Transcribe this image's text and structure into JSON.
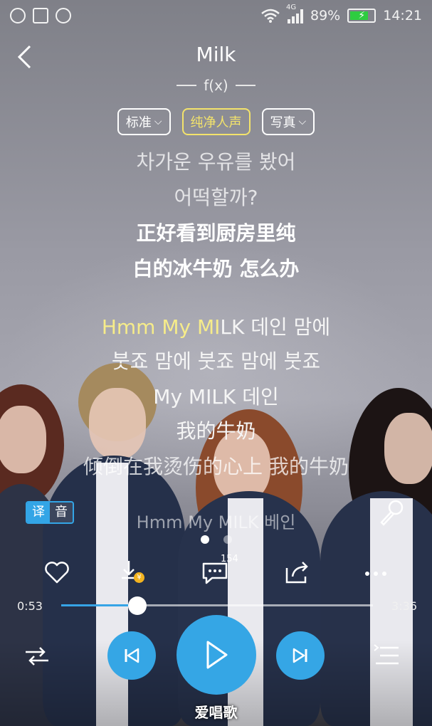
{
  "status": {
    "network": "4G",
    "battery": "89%",
    "time": "14:21"
  },
  "song": {
    "title": "Milk",
    "artist": "f(x)"
  },
  "chips": [
    {
      "label": "标准",
      "icon": "chevron-down-icon"
    },
    {
      "label": "纯净人声",
      "active": true
    },
    {
      "label": "写真",
      "icon": "chevron-down-icon"
    }
  ],
  "lyrics": {
    "l1": "차가운 우유를 봤어",
    "l2": "어떡할까?",
    "l3": "正好看到厨房里纯",
    "l4": "白的冰牛奶 怎么办",
    "l5_hl": "Hmm My MI",
    "l5_rest": "LK 데인 맘에",
    "l6": "붓죠 맘에 붓죠 맘에 붓죠",
    "l7": "My MILK 데인",
    "l8": "我的牛奶",
    "l9": "倾倒在我烫伤的心上 我的牛奶",
    "l10": "Hmm My MILK 베인"
  },
  "translate": {
    "on": "译",
    "off": "音"
  },
  "actions": {
    "comment_count": "154",
    "download_badge": "¥"
  },
  "progress": {
    "current": "0:53",
    "total": "3:36",
    "fraction": 0.245
  },
  "watermark": "爱唱歌",
  "colors": {
    "accent": "#35a6e5",
    "highlight": "#f6ec8a",
    "chip_active": "#f3e36b"
  }
}
